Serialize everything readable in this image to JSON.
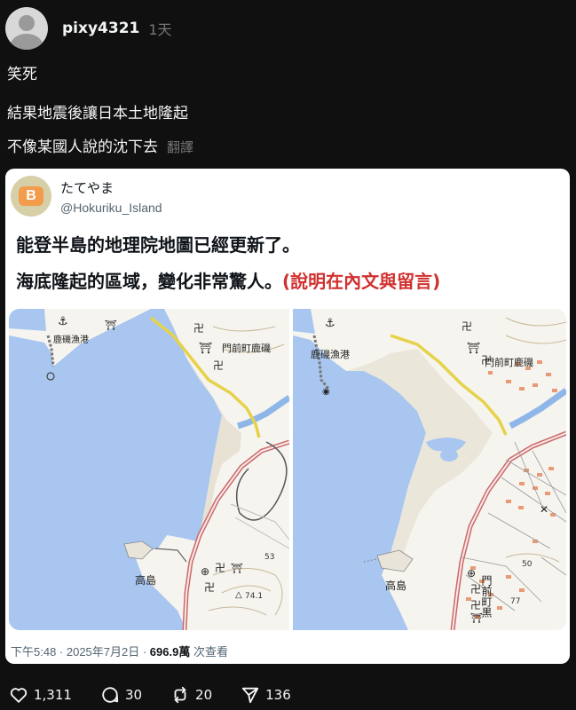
{
  "post": {
    "username": "pixy4321",
    "time": "1天",
    "lines": [
      "笑死",
      "結果地震後讓日本土地隆起",
      "不像某國人說的沈下去"
    ],
    "translate_label": "翻譯"
  },
  "embed": {
    "display_name": "たてやま",
    "handle": "@Hokuriku_Island",
    "avatar_letter": "B",
    "text_line1": "能登半島的地理院地圖已經更新了。",
    "text_line2": "海底隆起的區域，變化非常驚人。",
    "text_line2_red": "(說明在內文與留言)",
    "meta_time": "下午5:48 · 2025年7月2日 · ",
    "meta_views": "696.9萬",
    "meta_views_suffix": " 次查看",
    "map_left": {
      "label_port": "鹿磯漁港",
      "label_town": "門前町鹿磯",
      "label_island": "高島",
      "label_53": "53",
      "label_741": "74.1"
    },
    "map_right": {
      "label_port": "鹿磯漁港",
      "label_town": "門前町鹿磯",
      "label_island": "高島",
      "label_town_vertical": "門前町黒",
      "label_50": "50",
      "label_77": "77"
    }
  },
  "actions": {
    "likes": "1,311",
    "comments": "30",
    "reposts": "20",
    "shares": "136"
  },
  "colors": {
    "background": "#101010",
    "text_primary": "#f3f5f7",
    "text_secondary": "#777777",
    "card_bg": "#ffffff",
    "accent_red": "#d0302f",
    "sea": "#a8c6f0",
    "land": "#f6f4ef"
  }
}
